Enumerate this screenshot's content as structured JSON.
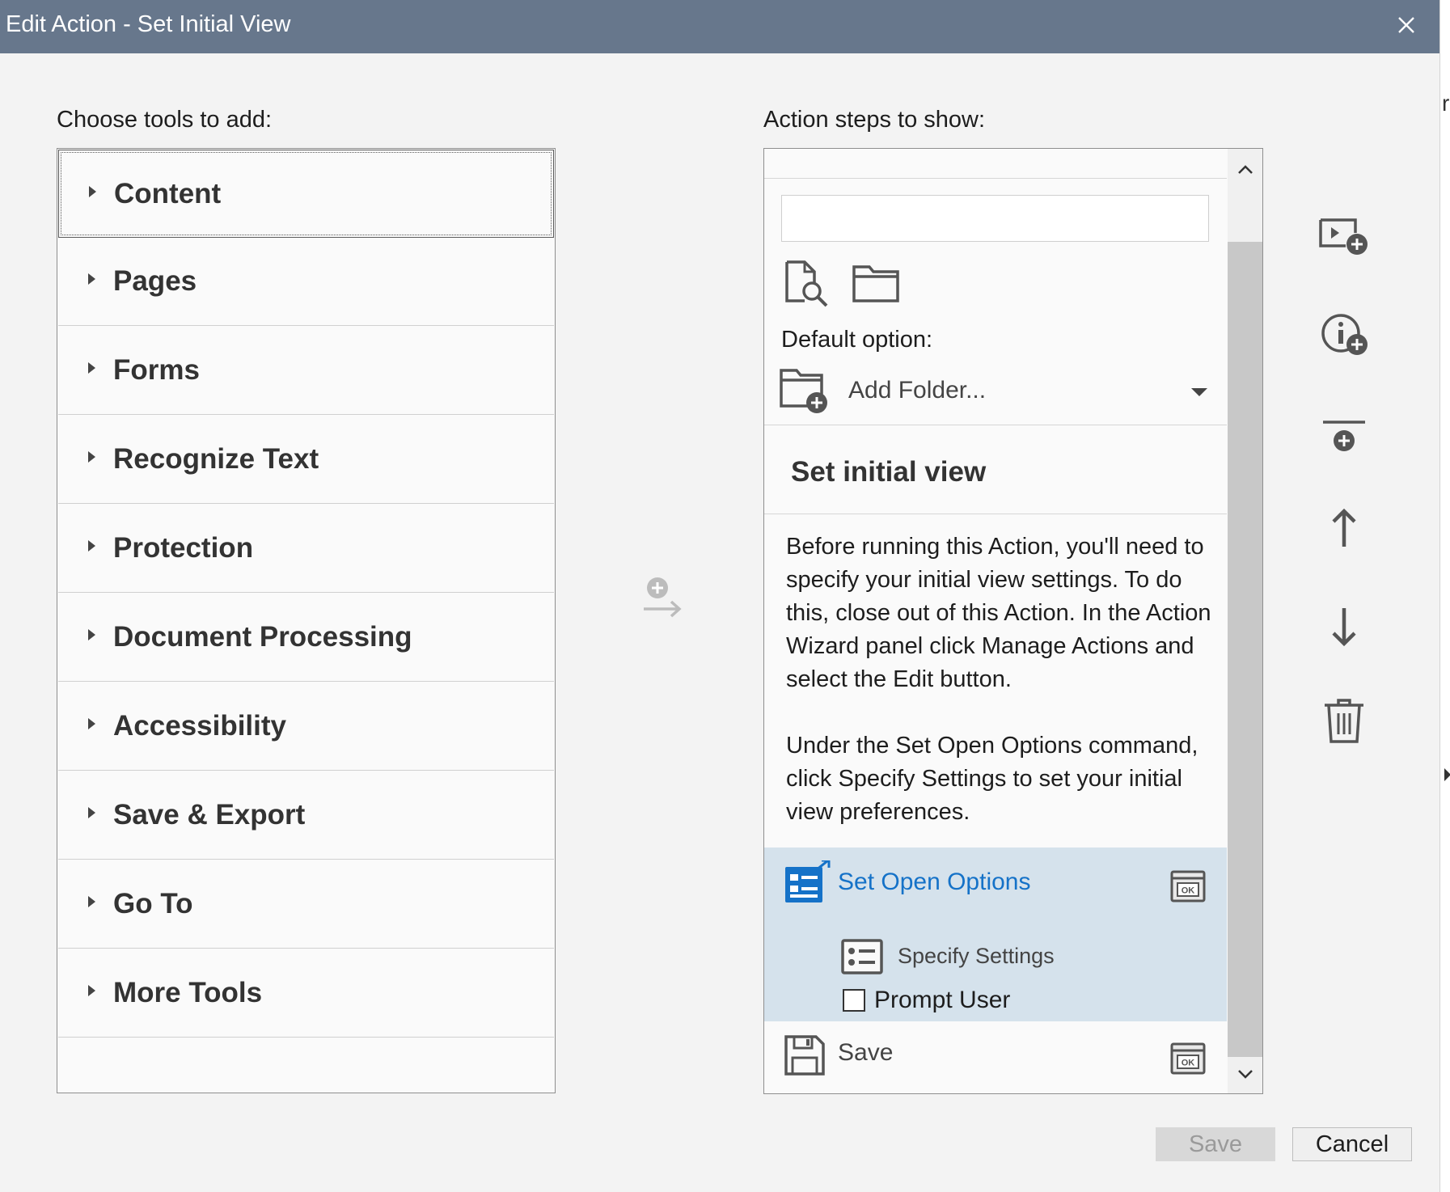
{
  "window": {
    "title": "Edit Action - Set Initial View"
  },
  "left_panel": {
    "label": "Choose tools to add:",
    "tools": [
      {
        "label": "Content"
      },
      {
        "label": "Pages"
      },
      {
        "label": "Forms"
      },
      {
        "label": "Recognize Text"
      },
      {
        "label": "Protection"
      },
      {
        "label": "Document Processing"
      },
      {
        "label": "Accessibility"
      },
      {
        "label": "Save & Export"
      },
      {
        "label": "Go To"
      },
      {
        "label": "More Tools"
      }
    ]
  },
  "right_panel": {
    "label": "Action steps to show:",
    "name_input": {
      "value": "",
      "placeholder": ""
    },
    "default_option_label": "Default option:",
    "default_option_value": "Add Folder...",
    "section_title": "Set initial view",
    "instructions": [
      "Before running this Action, you'll need to specify your initial view settings. To do this, close out of this Action. In the Action Wizard panel click Manage Actions and select the Edit button.",
      "Under the Set Open Options command, click Specify Settings to set your initial view preferences."
    ],
    "steps": {
      "set_open_options": "Set Open Options",
      "specify_settings": "Specify Settings",
      "prompt_user": "Prompt User",
      "prompt_user_checked": false,
      "save": "Save"
    }
  },
  "side_icons": [
    "add-action-step-icon",
    "add-instruction-icon",
    "add-divider-icon",
    "move-up-icon",
    "move-down-icon",
    "delete-icon"
  ],
  "buttons": {
    "save": "Save",
    "cancel": "Cancel",
    "save_enabled": false
  },
  "colors": {
    "titlebar": "#67778c",
    "accent": "#1572c8",
    "selected_step": "#d5e2ec"
  }
}
